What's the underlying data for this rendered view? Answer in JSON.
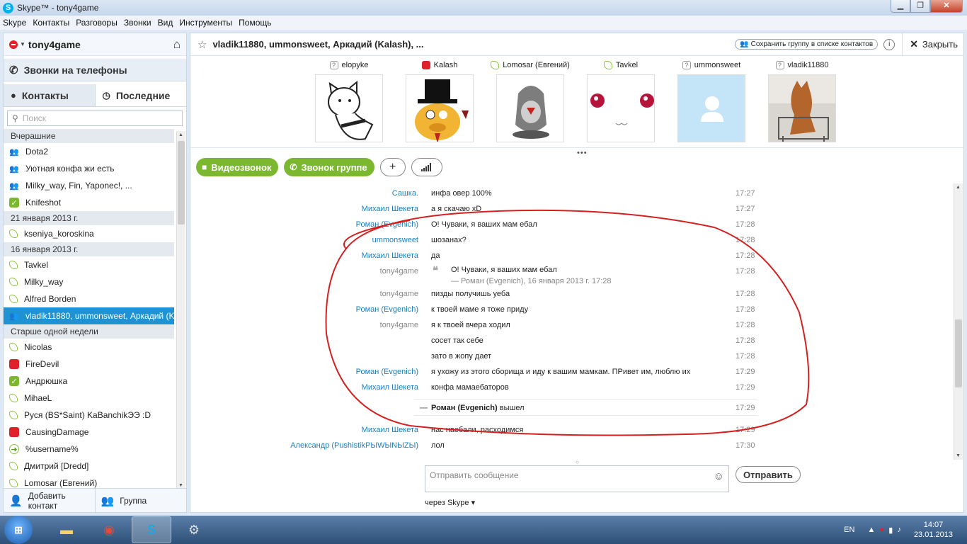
{
  "window": {
    "title": "Skype™ - tony4game",
    "min": "▁",
    "max": "❐",
    "close": "✕"
  },
  "menu": [
    "Skype",
    "Контакты",
    "Разговоры",
    "Звонки",
    "Вид",
    "Инструменты",
    "Помощь"
  ],
  "profile": {
    "name": "tony4game"
  },
  "calls_label": "Звонки на телефоны",
  "tabs": {
    "contacts": "Контакты",
    "recent": "Последние"
  },
  "search": {
    "placeholder": "Поиск"
  },
  "contacts": [
    {
      "type": "section",
      "label": "Вчерашние"
    },
    {
      "type": "group",
      "label": "Dota2"
    },
    {
      "type": "group",
      "label": "Уютная конфа жи есть"
    },
    {
      "type": "group",
      "label": "Milky_way, Fin, Yaponec!, ..."
    },
    {
      "type": "online",
      "label": "Knifeshot"
    },
    {
      "type": "section",
      "label": "21 января 2013 г."
    },
    {
      "type": "offline",
      "label": "kseniya_koroskina"
    },
    {
      "type": "section",
      "label": "16 января 2013 г."
    },
    {
      "type": "offline",
      "label": "Tavkel"
    },
    {
      "type": "offline",
      "label": "Milky_way"
    },
    {
      "type": "offline",
      "label": "Alfred Borden"
    },
    {
      "type": "selected",
      "label": "vladik11880, ummonsweet, Аркадий (K..."
    },
    {
      "type": "section",
      "label": "Старше одной недели"
    },
    {
      "type": "offline",
      "label": "Nicolas"
    },
    {
      "type": "red",
      "label": "FireDevil"
    },
    {
      "type": "online",
      "label": "Андрюшка"
    },
    {
      "type": "offline",
      "label": "MihaeL"
    },
    {
      "type": "offline",
      "label": "Руся (BS*Saint) KaBanchikЭЭ :D"
    },
    {
      "type": "red",
      "label": "CausingDamage"
    },
    {
      "type": "forward",
      "label": "%username%"
    },
    {
      "type": "offline",
      "label": "Дмитрий [Dredd]"
    },
    {
      "type": "offline",
      "label": "Lomosar (Евгений)"
    }
  ],
  "bottom": {
    "add_contact": "Добавить контакт",
    "group": "Группа"
  },
  "chat": {
    "title": "vladik11880, ummonsweet, Аркадий (Kalash), ...",
    "save_group": "Сохранить группу в списке контактов",
    "close": "Закрыть",
    "participants": [
      {
        "name": "elopyke",
        "status": "unknown"
      },
      {
        "name": "Kalash",
        "status": "red"
      },
      {
        "name": "Lomosar (Евгений)",
        "status": "offline"
      },
      {
        "name": "Tavkel",
        "status": "offline"
      },
      {
        "name": "ummonsweet",
        "status": "unknown"
      },
      {
        "name": "vladik11880",
        "status": "unknown"
      }
    ],
    "video_call": "Видеозвонок",
    "group_call": "Звонок группе",
    "messages": [
      {
        "who": "Сашка.",
        "text": "инфа овер 100%",
        "time": "17:27"
      },
      {
        "who": "Михаил Шекета",
        "text": "а я скачаю xD",
        "time": "17:27"
      },
      {
        "who": "Роман (Evgenich)",
        "text": "О! Чуваки, я ваших мам ебал",
        "time": "17:28"
      },
      {
        "who": "ummonsweet",
        "text": "шозанах?",
        "time": "17:28"
      },
      {
        "who": "Михаил Шекета",
        "text": "да",
        "time": "17:28"
      },
      {
        "who": "tony4game",
        "text": "пизды получишь уеба",
        "time": "17:28"
      },
      {
        "who": "Роман (Evgenich)",
        "text": "к твоей маме я тоже приду",
        "time": "17:28"
      },
      {
        "who": "tony4game",
        "text": "я к твоей вчера ходил",
        "time": "17:28"
      },
      {
        "who": "",
        "text": "сосет так себе",
        "time": "17:28"
      },
      {
        "who": "",
        "text": "зато в жопу дает",
        "time": "17:28"
      },
      {
        "who": "Роман (Evgenich)",
        "text": "я ухожу из этого сборища и иду к вашим мамкам. ПРивет им, люблю их",
        "time": "17:29"
      },
      {
        "who": "Михаил Шекета",
        "text": "конфа мамаебаторов",
        "time": "17:29"
      },
      {
        "who": "Михаил Шекета",
        "text": "нас наебали, расходимся",
        "time": "17:29"
      },
      {
        "who": "Александр (PushistikPЫWЫNЫZЫ)",
        "text": "лол",
        "time": "17:30"
      }
    ],
    "quote": {
      "text": "О! Чуваки, я ваших мам ебал",
      "attribution": "— Роман (Evgenich), 16 января 2013 г. 17:28",
      "time": "17:28"
    },
    "system": {
      "name": "Роман (Evgenich)",
      "text": " вышел",
      "time": "17:29"
    },
    "compose_placeholder": "Отправить сообщение",
    "send": "Отправить",
    "via": "через Skype"
  },
  "colors": {
    "skype_blue": "#00aff0",
    "selected": "#1e92d2",
    "green": "#7cb82f",
    "name_link": "#1e7fc0",
    "annotation": "#d42020"
  },
  "taskbar": {
    "lang": "EN",
    "time": "14:07",
    "date": "23.01.2013"
  }
}
